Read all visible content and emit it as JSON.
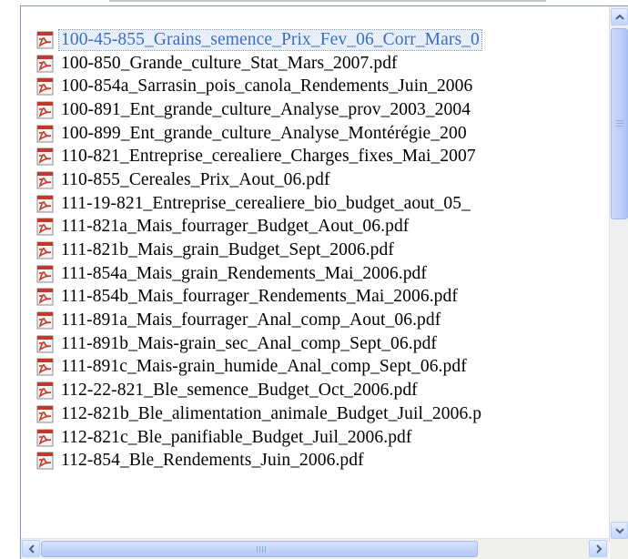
{
  "files": [
    {
      "name": "100-45-855_Grains_semence_Prix_Fev_06_Corr_Mars_0",
      "selected": true
    },
    {
      "name": "100-850_Grande_culture_Stat_Mars_2007.pdf"
    },
    {
      "name": "100-854a_Sarrasin_pois_canola_Rendements_Juin_2006"
    },
    {
      "name": "100-891_Ent_grande_culture_Analyse_prov_2003_2004"
    },
    {
      "name": "100-899_Ent_grande_culture_Analyse_Montérégie_200"
    },
    {
      "name": "110-821_Entreprise_cerealiere_Charges_fixes_Mai_2007"
    },
    {
      "name": "110-855_Cereales_Prix_Aout_06.pdf"
    },
    {
      "name": "111-19-821_Entreprise_cerealiere_bio_budget_aout_05_"
    },
    {
      "name": "111-821a_Mais_fourrager_Budget_Aout_06.pdf"
    },
    {
      "name": "111-821b_Mais_grain_Budget_Sept_2006.pdf"
    },
    {
      "name": "111-854a_Mais_grain_Rendements_Mai_2006.pdf"
    },
    {
      "name": "111-854b_Mais_fourrager_Rendements_Mai_2006.pdf"
    },
    {
      "name": "111-891a_Mais_fourrager_Anal_comp_Aout_06.pdf"
    },
    {
      "name": "111-891b_Mais-grain_sec_Anal_comp_Sept_06.pdf"
    },
    {
      "name": "111-891c_Mais-grain_humide_Anal_comp_Sept_06.pdf"
    },
    {
      "name": "112-22-821_Ble_semence_Budget_Oct_2006.pdf"
    },
    {
      "name": "112-821b_Ble_alimentation_animale_Budget_Juil_2006.p"
    },
    {
      "name": "112-821c_Ble_panifiable_Budget_Juil_2006.pdf"
    },
    {
      "name": "112-854_Ble_Rendements_Juin_2006.pdf"
    }
  ],
  "icons": {
    "file": "pdf-file-icon",
    "scroll_up": "arrow-up-icon",
    "scroll_down": "arrow-down-icon",
    "scroll_left": "arrow-left-icon",
    "scroll_right": "arrow-right-icon"
  },
  "colors": {
    "selection_text": "#3a6fbf",
    "scrollbar": "#c3d3fd"
  }
}
